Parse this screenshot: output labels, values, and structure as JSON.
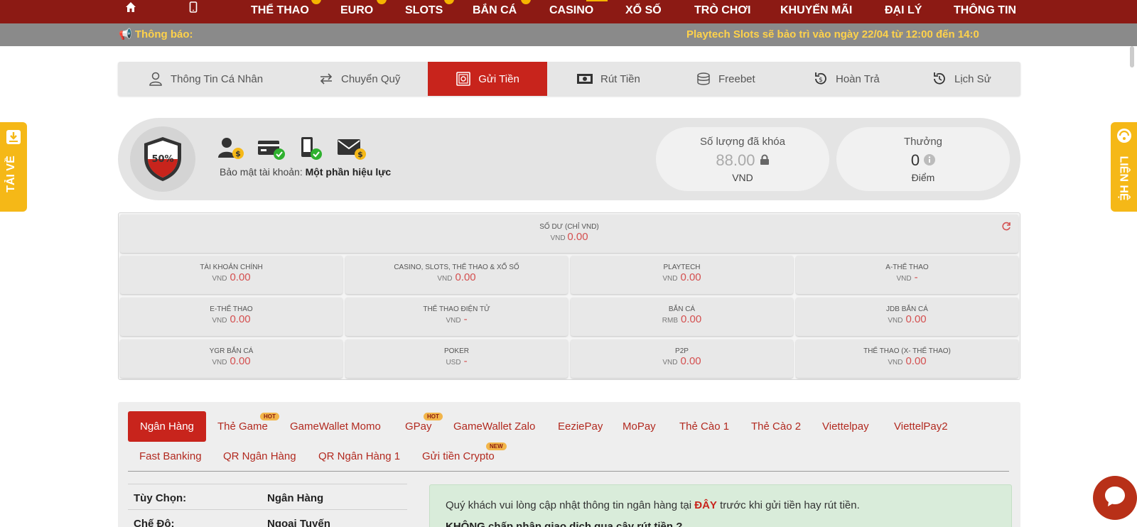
{
  "nav": {
    "items": [
      "THỂ THAO",
      "EURO",
      "SLOTS",
      "BẮN CÁ",
      "CASINO",
      "XỔ SỐ",
      "TRÒ CHƠI",
      "KHUYẾN MÃI",
      "ĐẠI LÝ",
      "THÔNG TIN"
    ]
  },
  "notice": {
    "label": "📢 Thông báo:",
    "message": "Playtech Slots sẽ bảo trì vào ngày 22/04 từ 12:00 đến 14:0"
  },
  "tabs": [
    {
      "label": "Thông Tin Cá Nhân",
      "icon": "user-icon"
    },
    {
      "label": "Chuyển Quỹ",
      "icon": "transfer-icon"
    },
    {
      "label": "Gửi Tiền",
      "icon": "safe-icon",
      "active": true
    },
    {
      "label": "Rút Tiền",
      "icon": "cash-icon"
    },
    {
      "label": "Freebet",
      "icon": "coins-icon"
    },
    {
      "label": "Hoàn Trả",
      "icon": "refund-icon"
    },
    {
      "label": "Lịch Sử",
      "icon": "history-icon"
    }
  ],
  "security": {
    "percent": "50%",
    "label": "Bảo mật tài khoản:",
    "status": "Một phần hiệu lực",
    "locked": {
      "title": "Số lượng đã khóa",
      "value": "88.00",
      "unit": "VND"
    },
    "bonus": {
      "title": "Thưởng",
      "value": "0",
      "unit": "Điểm"
    }
  },
  "balance": {
    "total": {
      "name": "SỐ DƯ (CHỈ VND)",
      "currency": "VND",
      "value": "0.00"
    },
    "cells": [
      {
        "name": "TÀI KHOẢN CHÍNH",
        "currency": "VND",
        "value": "0.00"
      },
      {
        "name": "CASINO, SLOTS, THỂ THAO & XỔ SỐ",
        "currency": "VND",
        "value": "0.00"
      },
      {
        "name": "PLAYTECH",
        "currency": "VND",
        "value": "0.00"
      },
      {
        "name": "A-THỂ THAO",
        "currency": "VND",
        "value": "-"
      },
      {
        "name": "E-THỂ THAO",
        "currency": "VND",
        "value": "0.00"
      },
      {
        "name": "THỂ THAO ĐIỆN TỬ",
        "currency": "VND",
        "value": "-"
      },
      {
        "name": "BẮN CÁ",
        "currency": "RMB",
        "value": "0.00"
      },
      {
        "name": "JDB BẮN CÁ",
        "currency": "VND",
        "value": "0.00"
      },
      {
        "name": "YGR BẮN CÁ",
        "currency": "VND",
        "value": "0.00"
      },
      {
        "name": "POKER",
        "currency": "USD",
        "value": "-"
      },
      {
        "name": "P2P",
        "currency": "VND",
        "value": "0.00"
      },
      {
        "name": "THỂ THAO (X- THỂ THAO)",
        "currency": "VND",
        "value": "0.00"
      }
    ]
  },
  "methods": {
    "row1": [
      "Ngân Hàng",
      "Thẻ Game",
      "GameWallet Momo",
      "GPay",
      "GameWallet Zalo",
      "EeziePay",
      "MoPay",
      "Thẻ Cào 1",
      "Thẻ Cào 2",
      "Viettelpay",
      "ViettelPay2"
    ],
    "row2": [
      "Fast Banking",
      "QR Ngân Hàng",
      "QR Ngân Hàng 1",
      "Gửi tiền Crypto"
    ],
    "badge_hot": "HOT",
    "badge_new": "NEW"
  },
  "options": {
    "choice_label": "Tùy Chọn:",
    "choice_value": "Ngân Hàng",
    "mode_label": "Chế Độ:",
    "mode_value": "Ngoại Tuyến"
  },
  "info": {
    "text_before": "Quý khách vui lòng cập nhật thông tin ngân hàng tại",
    "link": "ĐÂY",
    "text_after": "trước khi gửi tiền hay rút tiền.",
    "line2": "KHÔNG chấp nhận giao dịch qua cây rút tiền ?"
  },
  "side": {
    "left": "TẢI VỀ",
    "right": "LIÊN HỆ"
  },
  "colors": {
    "nav": "#8c1a14",
    "accent": "#c8241c",
    "gold": "#f5b817",
    "notice": "#ffd24a"
  }
}
